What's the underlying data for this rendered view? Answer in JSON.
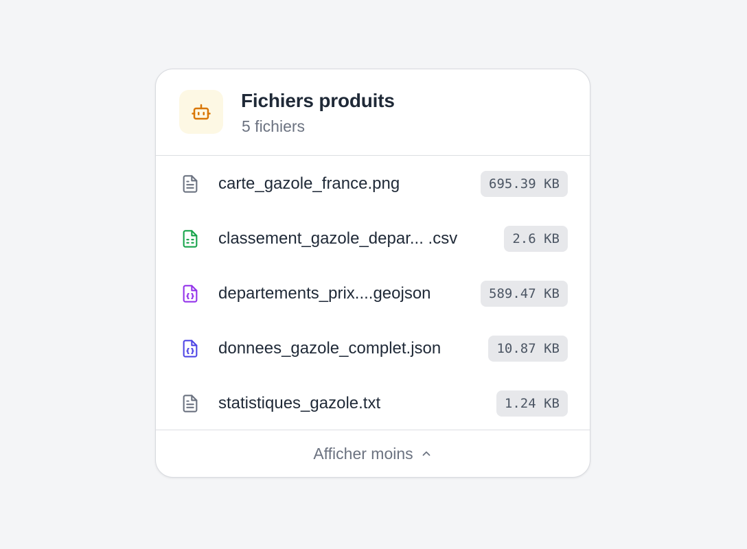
{
  "panel": {
    "icon": "robot-icon",
    "title": "Fichiers produits",
    "subtitle": "5 fichiers"
  },
  "files": [
    {
      "name": "carte_gazole_france.png",
      "size": "695.39 KB",
      "icon": "file-text-icon",
      "color": "#6b7280"
    },
    {
      "name": "classement_gazole_depar... .csv",
      "size": "2.6 KB",
      "icon": "file-spreadsheet-icon",
      "color": "#16a34a"
    },
    {
      "name": "departements_prix....geojson",
      "size": "589.47 KB",
      "icon": "file-code-icon",
      "color": "#9333ea"
    },
    {
      "name": "donnees_gazole_complet.json",
      "size": "10.87 KB",
      "icon": "file-code-icon",
      "color": "#4f46e5"
    },
    {
      "name": "statistiques_gazole.txt",
      "size": "1.24 KB",
      "icon": "file-text-icon",
      "color": "#6b7280"
    }
  ],
  "footer": {
    "label": "Afficher moins",
    "icon": "chevron-up-icon"
  },
  "colors": {
    "accent": "#d97706",
    "icon_bg": "#fdf8e4"
  }
}
